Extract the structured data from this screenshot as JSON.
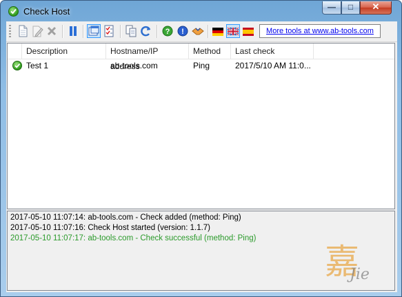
{
  "window": {
    "title": "Check Host"
  },
  "title_buttons": {
    "minimize": "—",
    "maximize": "□",
    "close": "✕"
  },
  "toolbar": {
    "icons": [
      "new-icon",
      "edit-icon",
      "delete-icon",
      "pause-icon",
      "view-icon",
      "checklist-icon",
      "copy-icon",
      "refresh-icon",
      "help-icon",
      "info-icon",
      "donate-icon",
      "flag-germany-icon",
      "flag-uk-icon",
      "flag-spain-icon"
    ],
    "more_tools_label": "More tools at www.ab-tools.com"
  },
  "table": {
    "columns": [
      "Description",
      "Hostname/IP address",
      "Method",
      "Last check"
    ],
    "rows": [
      {
        "status": "ok",
        "description": "Test 1",
        "host": "ab-tools.com",
        "method": "Ping",
        "last_check": "2017/5/10 AM 11:0..."
      }
    ]
  },
  "log": [
    {
      "text": "2017-05-10 11:07:14: ab-tools.com - Check added (method: Ping)",
      "color": "#000000"
    },
    {
      "text": "2017-05-10 11:07:16: Check Host started (version: 1.1.7)",
      "color": "#000000"
    },
    {
      "text": "2017-05-10 11:07:17: ab-tools.com - Check successful (method: Ping)",
      "color": "#2a9a2a"
    }
  ],
  "watermark": {
    "main": "嘉",
    "sub": "Jie"
  }
}
